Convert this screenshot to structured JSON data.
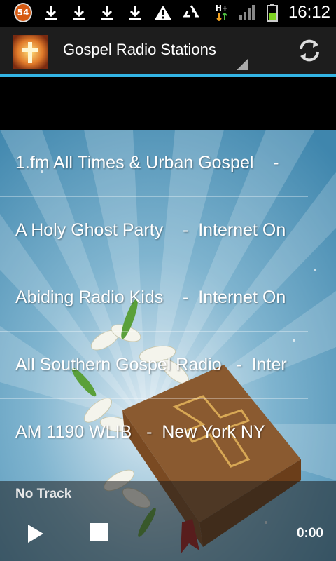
{
  "status_bar": {
    "notification_count": "54",
    "clock": "16:12",
    "network_label": "H+"
  },
  "action_bar": {
    "title": "Gospel Radio Stations"
  },
  "stations": [
    {
      "name": "1.fm All Times & Urban Gospel",
      "location": "-"
    },
    {
      "name": "A Holy Ghost Party",
      "location": "Internet On"
    },
    {
      "name": "Abiding Radio Kids",
      "location": "Internet On"
    },
    {
      "name": "All Southern Gospel Radio",
      "location": "Inter"
    },
    {
      "name": "AM 1190 WLIB",
      "location": "New York NY"
    }
  ],
  "player": {
    "track": "No Track",
    "time": "0:00"
  },
  "colors": {
    "accent": "#33b5e5",
    "background_blue": "#4a8fb3"
  }
}
